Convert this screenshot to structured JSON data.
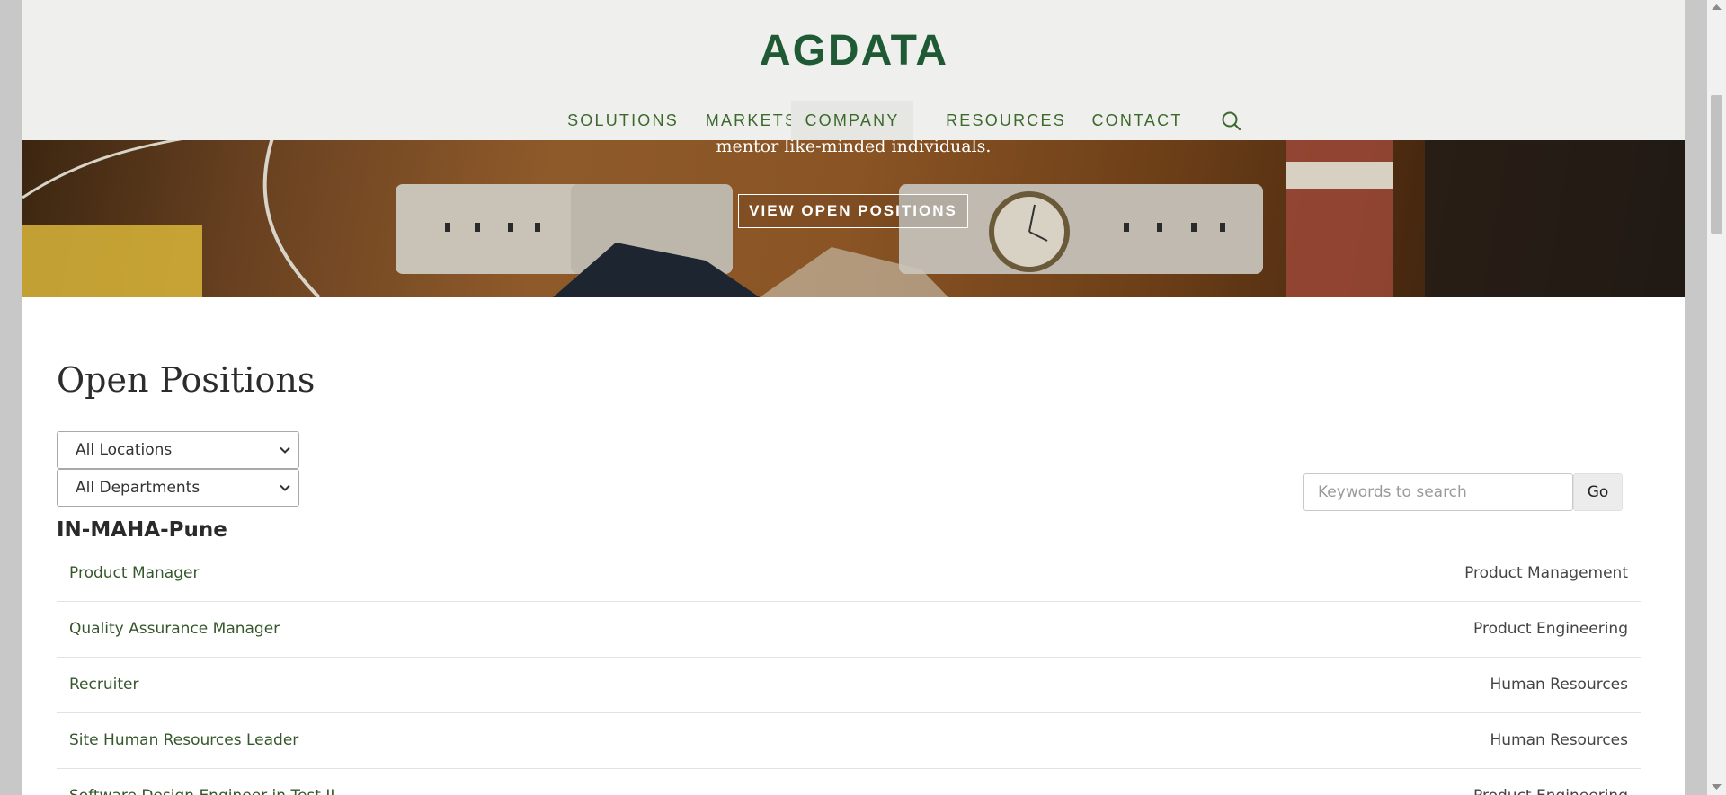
{
  "brand": {
    "logo_text": "AGDATA",
    "logo_color": "#1f5a34"
  },
  "nav": {
    "items": [
      {
        "label": "SOLUTIONS",
        "active": false
      },
      {
        "label": "MARKETS",
        "active": false
      },
      {
        "label": "COMPANY",
        "active": true
      },
      {
        "label": "RESOURCES",
        "active": false
      },
      {
        "label": "CONTACT",
        "active": false
      }
    ],
    "search_icon": "search-icon"
  },
  "hero": {
    "text": "mentor like-minded individuals.",
    "button_label": "VIEW OPEN POSITIONS"
  },
  "positions": {
    "title": "Open Positions",
    "location_filter": "All Locations",
    "department_filter": "All Departments",
    "search_placeholder": "Keywords to search",
    "go_label": "Go",
    "location_group": "IN-MAHA-Pune",
    "jobs": [
      {
        "title": "Product Manager",
        "department": "Product Management"
      },
      {
        "title": "Quality Assurance Manager",
        "department": "Product Engineering"
      },
      {
        "title": "Recruiter",
        "department": "Human Resources"
      },
      {
        "title": "Site Human Resources Leader",
        "department": "Human Resources"
      },
      {
        "title": "Software Design Engineer in Test II",
        "department": "Product Engineering"
      }
    ]
  },
  "colors": {
    "accent": "#3c6a2c",
    "link": "#36572b",
    "header_bg": "#efefed"
  }
}
